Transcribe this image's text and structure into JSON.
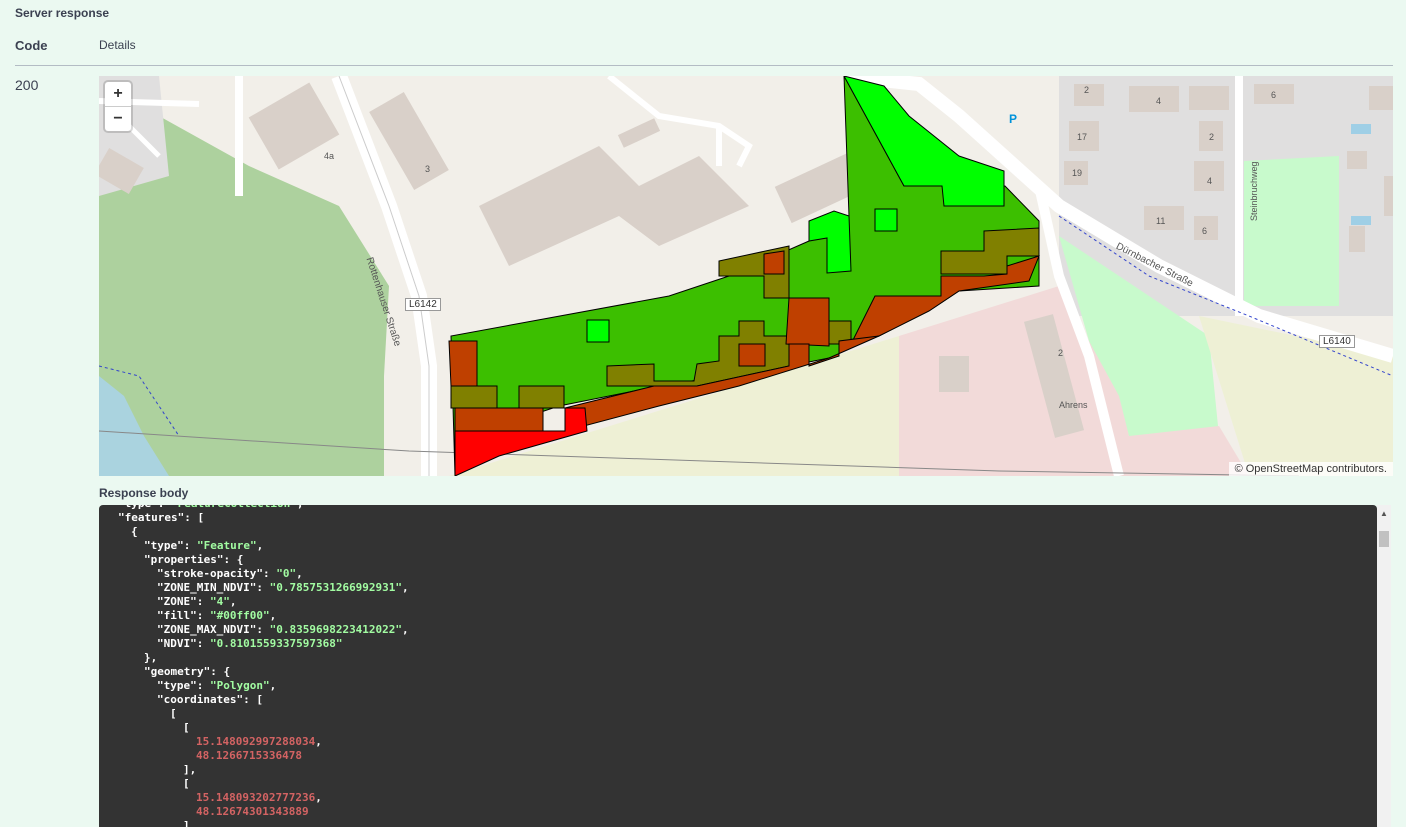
{
  "header": {
    "title": "Server response",
    "code_label": "Code",
    "details_label": "Details"
  },
  "response": {
    "status_code": "200",
    "body_label": "Response body"
  },
  "map": {
    "zoom_in": "+",
    "zoom_out": "−",
    "attribution": "© OpenStreetMap contributors.",
    "road_labels": [
      "L6142",
      "L6140"
    ],
    "street_names": [
      "Rottenhauser Straße",
      "Dürnbacher Straße",
      "Steinbruchweg"
    ],
    "poi_labels": [
      "Ahrens",
      "P"
    ],
    "house_numbers": [
      "4a",
      "3",
      "2",
      "4",
      "6",
      "17",
      "2",
      "19",
      "4",
      "11",
      "6",
      "2"
    ],
    "zone_colors": {
      "zone_high": "#00ff00",
      "zone_mid_high": "#3cbf00",
      "zone_mid": "#808000",
      "zone_low": "#bf4000",
      "zone_lowest": "#ff0000"
    }
  },
  "code_lines": [
    {
      "indent": 1,
      "parts": [
        {
          "t": "k",
          "v": "\"type\": "
        },
        {
          "t": "s",
          "v": "\"FeatureCollection\""
        },
        {
          "t": "k",
          "v": ","
        }
      ]
    },
    {
      "indent": 1,
      "parts": [
        {
          "t": "k",
          "v": "\"features\": ["
        }
      ]
    },
    {
      "indent": 2,
      "parts": [
        {
          "t": "k",
          "v": "{"
        }
      ]
    },
    {
      "indent": 3,
      "parts": [
        {
          "t": "k",
          "v": "\"type\": "
        },
        {
          "t": "s",
          "v": "\"Feature\""
        },
        {
          "t": "k",
          "v": ","
        }
      ]
    },
    {
      "indent": 3,
      "parts": [
        {
          "t": "k",
          "v": "\"properties\": {"
        }
      ]
    },
    {
      "indent": 4,
      "parts": [
        {
          "t": "k",
          "v": "\"stroke-opacity\": "
        },
        {
          "t": "s",
          "v": "\"0\""
        },
        {
          "t": "k",
          "v": ","
        }
      ]
    },
    {
      "indent": 4,
      "parts": [
        {
          "t": "k",
          "v": "\"ZONE_MIN_NDVI\": "
        },
        {
          "t": "s",
          "v": "\"0.7857531266992931\""
        },
        {
          "t": "k",
          "v": ","
        }
      ]
    },
    {
      "indent": 4,
      "parts": [
        {
          "t": "k",
          "v": "\"ZONE\": "
        },
        {
          "t": "s",
          "v": "\"4\""
        },
        {
          "t": "k",
          "v": ","
        }
      ]
    },
    {
      "indent": 4,
      "parts": [
        {
          "t": "k",
          "v": "\"fill\": "
        },
        {
          "t": "s",
          "v": "\"#00ff00\""
        },
        {
          "t": "k",
          "v": ","
        }
      ]
    },
    {
      "indent": 4,
      "parts": [
        {
          "t": "k",
          "v": "\"ZONE_MAX_NDVI\": "
        },
        {
          "t": "s",
          "v": "\"0.8359698223412022\""
        },
        {
          "t": "k",
          "v": ","
        }
      ]
    },
    {
      "indent": 4,
      "parts": [
        {
          "t": "k",
          "v": "\"NDVI\": "
        },
        {
          "t": "s",
          "v": "\"0.8101559337597368\""
        }
      ]
    },
    {
      "indent": 3,
      "parts": [
        {
          "t": "k",
          "v": "},"
        }
      ]
    },
    {
      "indent": 3,
      "parts": [
        {
          "t": "k",
          "v": "\"geometry\": {"
        }
      ]
    },
    {
      "indent": 4,
      "parts": [
        {
          "t": "k",
          "v": "\"type\": "
        },
        {
          "t": "s",
          "v": "\"Polygon\""
        },
        {
          "t": "k",
          "v": ","
        }
      ]
    },
    {
      "indent": 4,
      "parts": [
        {
          "t": "k",
          "v": "\"coordinates\": ["
        }
      ]
    },
    {
      "indent": 5,
      "parts": [
        {
          "t": "k",
          "v": "["
        }
      ]
    },
    {
      "indent": 6,
      "parts": [
        {
          "t": "k",
          "v": "["
        }
      ]
    },
    {
      "indent": 7,
      "parts": [
        {
          "t": "n",
          "v": "15.148092997288034"
        },
        {
          "t": "k",
          "v": ","
        }
      ]
    },
    {
      "indent": 7,
      "parts": [
        {
          "t": "n",
          "v": "48.1266715336478"
        }
      ]
    },
    {
      "indent": 6,
      "parts": [
        {
          "t": "k",
          "v": "],"
        }
      ]
    },
    {
      "indent": 6,
      "parts": [
        {
          "t": "k",
          "v": "["
        }
      ]
    },
    {
      "indent": 7,
      "parts": [
        {
          "t": "n",
          "v": "15.148093202777236"
        },
        {
          "t": "k",
          "v": ","
        }
      ]
    },
    {
      "indent": 7,
      "parts": [
        {
          "t": "n",
          "v": "48.12674301343889"
        }
      ]
    },
    {
      "indent": 6,
      "parts": [
        {
          "t": "k",
          "v": "],"
        }
      ]
    }
  ]
}
